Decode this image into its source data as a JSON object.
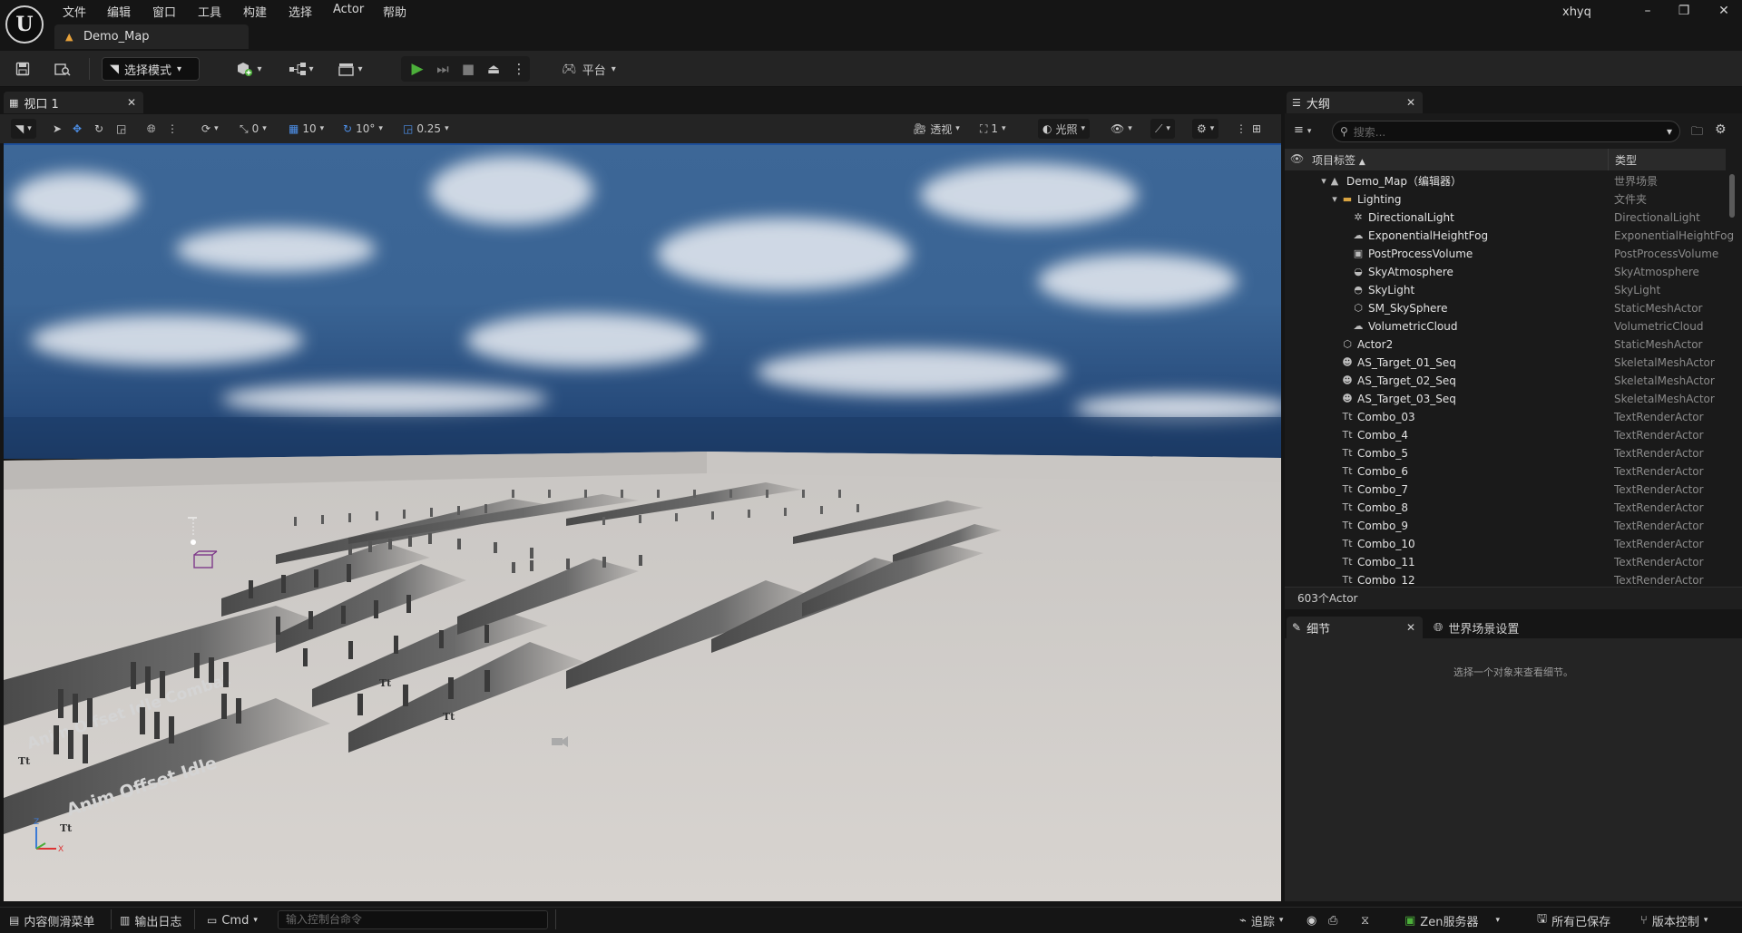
{
  "app": {
    "logo_text": "U",
    "menus": [
      "文件",
      "编辑",
      "窗口",
      "工具",
      "构建",
      "选择",
      "Actor",
      "帮助"
    ],
    "document_tab": "Demo_Map",
    "user": "xhyq",
    "window_buttons": [
      "minimize-icon",
      "restore-icon",
      "close-icon"
    ]
  },
  "toolbar": {
    "mode_label": "选择模式",
    "platform_label": "平台"
  },
  "viewport": {
    "tab_label": "视口 1",
    "translate_snap": "0",
    "grid_snap": "10",
    "rotate_snap": "10°",
    "scale_snap": "0.25",
    "view_mode": "透视",
    "camera_speed": "1",
    "lighting_mode": "光照",
    "scene_labels": [
      "Anim Offset Idle",
      "Anim Offset Idle Combat"
    ],
    "axis_labels": [
      "Z",
      "X",
      "Y"
    ]
  },
  "outliner": {
    "tab_label": "大纲",
    "search_placeholder": "搜索...",
    "col_label": "项目标签",
    "col_type": "类型",
    "footer": "603个Actor",
    "items": [
      {
        "name": "Demo_Map（编辑器）",
        "type": "世界场景",
        "icon": "map-icon"
      },
      {
        "name": "Lighting",
        "type": "文件夹",
        "icon": "folder-icon"
      },
      {
        "name": "DirectionalLight",
        "type": "DirectionalLight",
        "icon": "sun-icon"
      },
      {
        "name": "ExponentialHeightFog",
        "type": "ExponentialHeightFog",
        "icon": "fog-icon"
      },
      {
        "name": "PostProcessVolume",
        "type": "PostProcessVolume",
        "icon": "volume-icon"
      },
      {
        "name": "SkyAtmosphere",
        "type": "SkyAtmosphere",
        "icon": "atmosphere-icon"
      },
      {
        "name": "SkyLight",
        "type": "SkyLight",
        "icon": "skylight-icon"
      },
      {
        "name": "SM_SkySphere",
        "type": "StaticMeshActor",
        "icon": "mesh-icon"
      },
      {
        "name": "VolumetricCloud",
        "type": "VolumetricCloud",
        "icon": "cloud-icon"
      },
      {
        "name": "Actor2",
        "type": "StaticMeshActor",
        "icon": "mesh-icon"
      },
      {
        "name": "AS_Target_01_Seq",
        "type": "SkeletalMeshActor",
        "icon": "skeleton-icon"
      },
      {
        "name": "AS_Target_02_Seq",
        "type": "SkeletalMeshActor",
        "icon": "skeleton-icon"
      },
      {
        "name": "AS_Target_03_Seq",
        "type": "SkeletalMeshActor",
        "icon": "skeleton-icon"
      },
      {
        "name": "Combo_03",
        "type": "TextRenderActor",
        "icon": "text-render-icon"
      },
      {
        "name": "Combo_4",
        "type": "TextRenderActor",
        "icon": "text-render-icon"
      },
      {
        "name": "Combo_5",
        "type": "TextRenderActor",
        "icon": "text-render-icon"
      },
      {
        "name": "Combo_6",
        "type": "TextRenderActor",
        "icon": "text-render-icon"
      },
      {
        "name": "Combo_7",
        "type": "TextRenderActor",
        "icon": "text-render-icon"
      },
      {
        "name": "Combo_8",
        "type": "TextRenderActor",
        "icon": "text-render-icon"
      },
      {
        "name": "Combo_9",
        "type": "TextRenderActor",
        "icon": "text-render-icon"
      },
      {
        "name": "Combo_10",
        "type": "TextRenderActor",
        "icon": "text-render-icon"
      },
      {
        "name": "Combo_11",
        "type": "TextRenderActor",
        "icon": "text-render-icon"
      },
      {
        "name": "Combo_12",
        "type": "TextRenderActor",
        "icon": "text-render-icon"
      }
    ]
  },
  "details": {
    "tab_label": "细节",
    "tab2_label": "世界场景设置",
    "empty_message": "选择一个对象来查看细节。"
  },
  "statusbar": {
    "content_drawer": "内容侧滑菜单",
    "output_log": "输出日志",
    "cmd_label": "Cmd",
    "cmd_placeholder": "输入控制台命令",
    "trace_label": "追踪",
    "zen_label": "Zen服务器",
    "save_status": "所有已保存",
    "source_control": "版本控制"
  },
  "colors": {
    "accent_blue": "#1e4f9a",
    "play_green": "#4caf3a",
    "bg_dark": "#151515",
    "panel": "#242424"
  }
}
